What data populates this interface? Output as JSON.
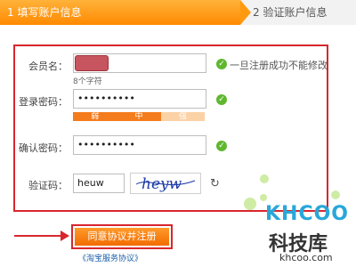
{
  "steps": {
    "step1": "1 填写账户信息",
    "step2": "2 验证账户信息"
  },
  "form": {
    "username": {
      "label": "会员名：",
      "hint": "一旦注册成功不能修改",
      "sub_hint": "8个字符"
    },
    "password": {
      "label": "登录密码：",
      "value": "••••••••••",
      "strength": [
        "弱",
        "中",
        "强"
      ]
    },
    "confirm_password": {
      "label": "确认密码：",
      "value": "••••••••••"
    },
    "captcha": {
      "label": "验证码：",
      "value": "heuw",
      "image_text": "heyw"
    }
  },
  "submit": {
    "button_label": "同意协议并注册",
    "agreement_link": "《淘宝服务协议》"
  },
  "watermark": {
    "logo": "KHCOO",
    "name": "科技库",
    "url": "khcoo.com"
  },
  "colors": {
    "accent": "#f28b00",
    "highlight_border": "#d8262d",
    "success": "#5fb830",
    "link": "#1a5fa8"
  }
}
